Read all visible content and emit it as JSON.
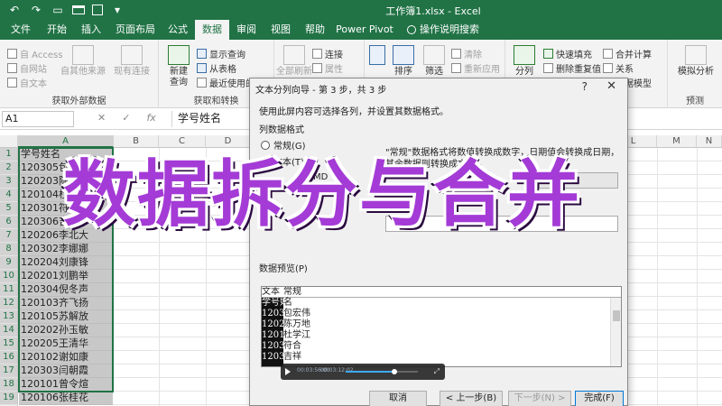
{
  "window": {
    "title": "工作簿1.xlsx  -  Excel"
  },
  "ribbon_tabs": [
    "文件",
    "开始",
    "插入",
    "页面布局",
    "公式",
    "数据",
    "审阅",
    "视图",
    "帮助",
    "Power Pivot",
    "操作说明搜索"
  ],
  "ribbon": {
    "external_data": {
      "access": "自 Access",
      "web": "自网站",
      "text": "自文本",
      "other": "自其他来源",
      "existing": "现有连接",
      "group_label": "获取外部数据"
    },
    "get_transform": {
      "new_query": "新建",
      "new_query2": "查询",
      "show_query": "显示查询",
      "from_table": "从表格",
      "recent": "最近使用的源",
      "group_label": "获取和转换"
    },
    "connections": {
      "refresh": "全部刷新",
      "connections": "连接",
      "properties": "属性"
    },
    "sort_filter": {
      "sort": "排序",
      "filter": "筛选",
      "clear": "清除",
      "reapply": "重新应用"
    },
    "data_tools": {
      "split": "分列",
      "flash_fill": "快速填充",
      "remove_dup": "删除重复值",
      "consolidate": "合并计算",
      "relations": "关系",
      "data_model": "数据模型"
    },
    "forecast": {
      "what_if": "模拟分析",
      "group_label": "预测"
    }
  },
  "formula_bar": {
    "name_box": "A1",
    "cancel": "✕",
    "enter": "✓",
    "fx": "fx",
    "content": "学号姓名"
  },
  "columns": [
    "A",
    "B",
    "C",
    "D",
    "L",
    "M",
    "N"
  ],
  "rows": [
    {
      "n": "1",
      "a": "学号姓名"
    },
    {
      "n": "2",
      "a": "120305包宏伟"
    },
    {
      "n": "3",
      "a": "120203陈万地"
    },
    {
      "n": "4",
      "a": "120104杜学江"
    },
    {
      "n": "5",
      "a": "120301符合"
    },
    {
      "n": "6",
      "a": "120306吉祥"
    },
    {
      "n": "7",
      "a": "120206李北大"
    },
    {
      "n": "8",
      "a": "120302李娜娜"
    },
    {
      "n": "9",
      "a": "120204刘康锋"
    },
    {
      "n": "10",
      "a": "120201刘鹏举"
    },
    {
      "n": "11",
      "a": "120304倪冬声"
    },
    {
      "n": "12",
      "a": "120103齐飞扬"
    },
    {
      "n": "13",
      "a": "120105苏解放"
    },
    {
      "n": "14",
      "a": "120202孙玉敏"
    },
    {
      "n": "15",
      "a": "120205王清华"
    },
    {
      "n": "16",
      "a": "120102谢如康"
    },
    {
      "n": "17",
      "a": "120303闫朝霞"
    },
    {
      "n": "18",
      "a": "120101曾令煊"
    },
    {
      "n": "19",
      "a": "120106张桂花"
    },
    {
      "n": "20",
      "a": ""
    }
  ],
  "dialog": {
    "title": "文本分列向导 - 第 3 步，共 3 步",
    "help": "?",
    "close": "✕",
    "description": "使用此屏内容可选择各列，并设置其数据格式。",
    "section": "列数据格式",
    "radio_general": "常规(G)",
    "radio_text": "文本(T)",
    "radio_date_frag": "MD",
    "note": "\"常规\"数据格式将数值转换成数字，日期值会转换成日期，其余数据则转换成文本。",
    "preview_label": "数据预览(P)",
    "preview_header_a": "文本",
    "preview_header_b": "常规",
    "preview_lines": [
      {
        "a": "学号姓",
        "b": "名"
      },
      {
        "a": "120305",
        "b": "包宏伟"
      },
      {
        "a": "120203",
        "b": "陈万地"
      },
      {
        "a": "120104",
        "b": "杜学江"
      },
      {
        "a": "120301",
        "b": "符合"
      },
      {
        "a": "120306",
        "b": "吉祥"
      }
    ],
    "buttons": {
      "cancel": "取消",
      "back": "< 上一步(B)",
      "next": "下一步(N) >",
      "finish": "完成(F)"
    }
  },
  "video_bar": {
    "time_current": "00:03:56:00",
    "time_total": "00:03:12:02",
    "progress": 0.68
  },
  "overlay_title": "数据拆分与合并"
}
